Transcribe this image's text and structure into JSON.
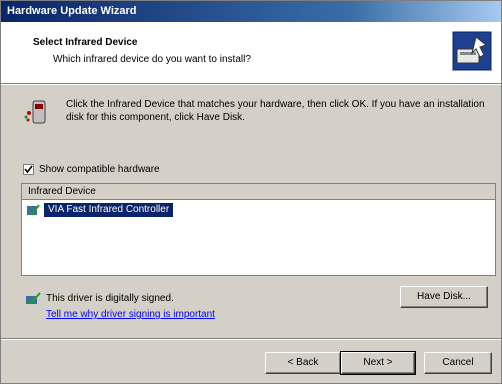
{
  "window": {
    "title": "Hardware Update Wizard"
  },
  "header": {
    "title": "Select Infrared Device",
    "subtitle": "Which infrared device do you want to install?"
  },
  "intro": {
    "text": "Click the Infrared Device that matches your hardware, then click OK. If you have an installation disk for this component, click Have Disk."
  },
  "compatible": {
    "label": "Show compatible hardware",
    "checked": true
  },
  "list": {
    "column": "Infrared Device",
    "items": [
      "VIA Fast Infrared Controller"
    ],
    "selected_index": 0
  },
  "driver": {
    "status": "This driver is digitally signed.",
    "link": "Tell me why driver signing is important"
  },
  "buttons": {
    "have_disk": "Have Disk...",
    "back": "< Back",
    "next": "Next >",
    "cancel": "Cancel"
  },
  "colors": {
    "title_bar": "#0a246a",
    "selection": "#0a246a",
    "face": "#d4d0c8",
    "link": "#0000ff"
  }
}
